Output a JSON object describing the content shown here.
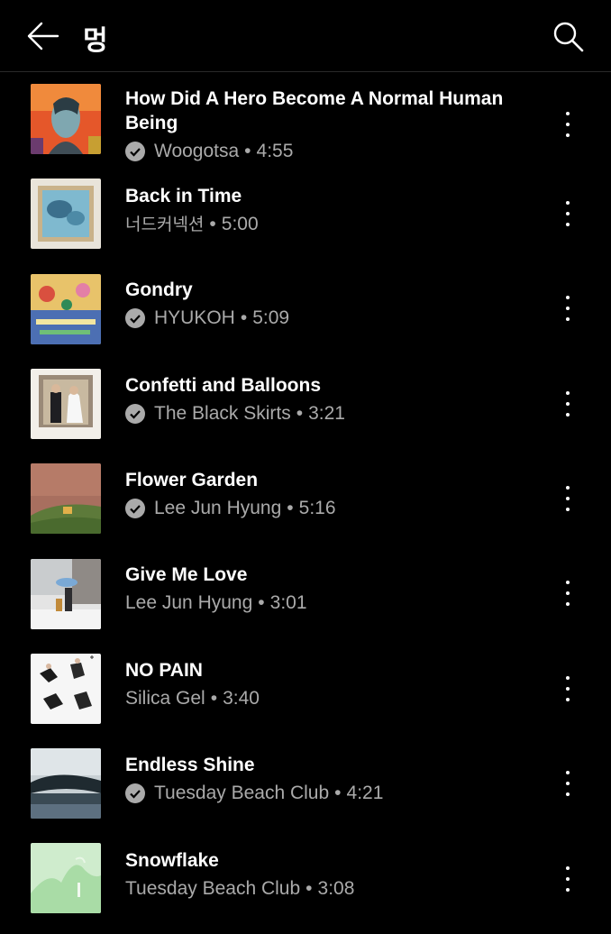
{
  "header": {
    "title": "멍",
    "back_icon": "arrow-left-icon",
    "search_icon": "search-icon"
  },
  "songs": [
    {
      "title_line1": "How Did A Hero Become A Normal Human",
      "title_line2": "Being",
      "artist": "Woogotsa",
      "duration": "4:55",
      "verified": true
    },
    {
      "title_line1": "Back in Time",
      "title_line2": "",
      "artist": "너드커넥션",
      "duration": "5:00",
      "verified": false
    },
    {
      "title_line1": "Gondry",
      "title_line2": "",
      "artist": "HYUKOH",
      "duration": "5:09",
      "verified": true
    },
    {
      "title_line1": "Confetti and Balloons",
      "title_line2": "",
      "artist": "The Black Skirts",
      "duration": "3:21",
      "verified": true
    },
    {
      "title_line1": "Flower Garden",
      "title_line2": "",
      "artist": "Lee Jun Hyung",
      "duration": "5:16",
      "verified": true
    },
    {
      "title_line1": "Give Me Love",
      "title_line2": "",
      "artist": "Lee Jun Hyung",
      "duration": "3:01",
      "verified": false
    },
    {
      "title_line1": "NO PAIN",
      "title_line2": "",
      "artist": "Silica Gel",
      "duration": "3:40",
      "verified": false
    },
    {
      "title_line1": "Endless Shine",
      "title_line2": "",
      "artist": "Tuesday Beach Club",
      "duration": "4:21",
      "verified": true
    },
    {
      "title_line1": "Snowflake",
      "title_line2": "",
      "artist": "Tuesday Beach Club",
      "duration": "3:08",
      "verified": false
    }
  ],
  "separator": "•",
  "icons": {
    "verified": "check-circle-icon",
    "more": "more-vert-icon"
  }
}
